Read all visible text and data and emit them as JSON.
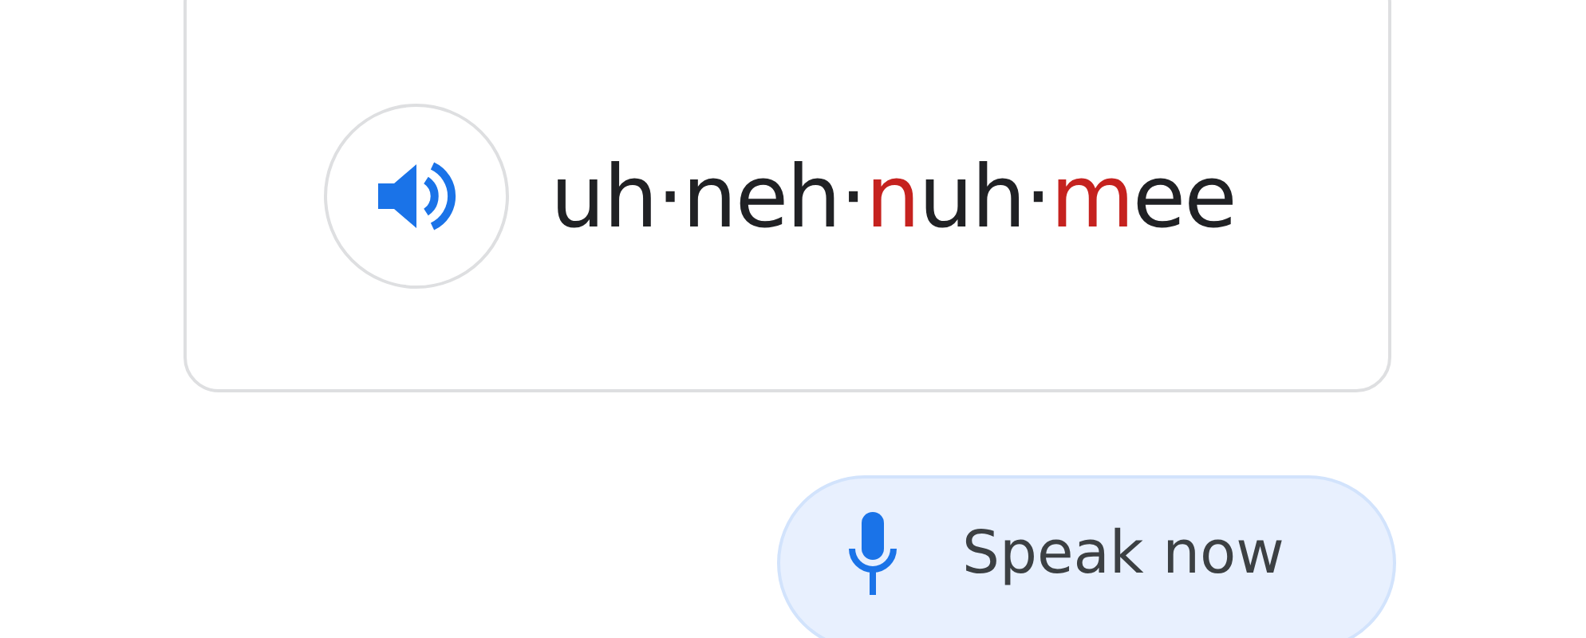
{
  "pronunciation": {
    "segments": [
      {
        "text": "uh·neh·",
        "highlight": false
      },
      {
        "text": "n",
        "highlight": true
      },
      {
        "text": "uh·",
        "highlight": false
      },
      {
        "text": "m",
        "highlight": true
      },
      {
        "text": "ee",
        "highlight": false
      }
    ]
  },
  "speak_button": {
    "label": "Speak now"
  }
}
